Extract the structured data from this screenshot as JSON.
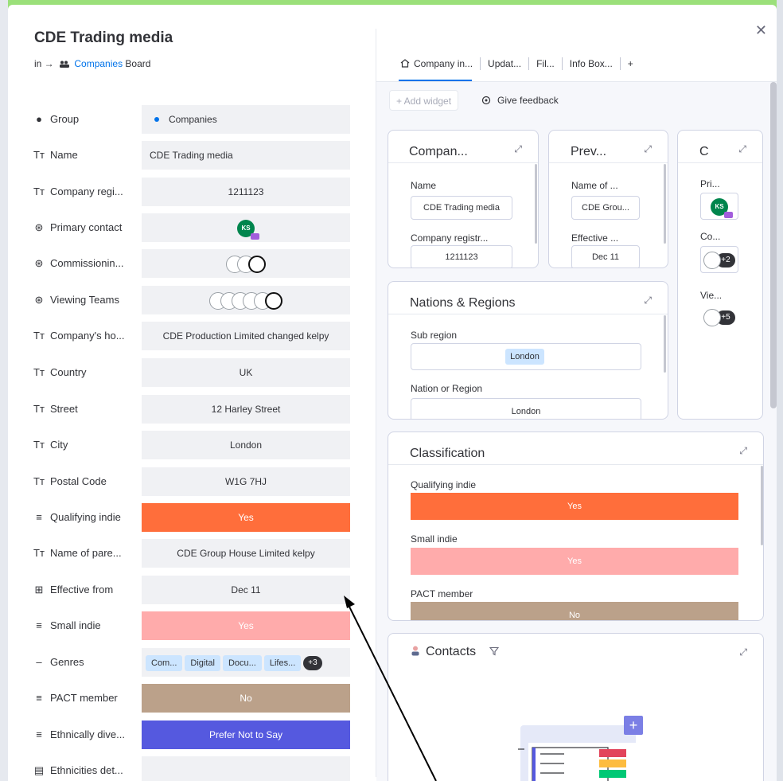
{
  "window": {
    "title": "CDE Trading media",
    "breadcrumb_prefix": "in →",
    "breadcrumb_link": "Companies",
    "breadcrumb_suffix": " Board"
  },
  "fields": [
    {
      "icon": "●",
      "label": "Group",
      "value": "Companies"
    },
    {
      "icon": "Tᴛ",
      "label": "Name",
      "value": "CDE Trading media"
    },
    {
      "icon": "Tᴛ",
      "label": "Company regi...",
      "value": "1211123"
    },
    {
      "icon": "⊛",
      "label": "Primary contact",
      "value": "KS"
    },
    {
      "icon": "⊛",
      "label": "Commissionin...",
      "value": ""
    },
    {
      "icon": "⊛",
      "label": "Viewing Teams",
      "value": ""
    },
    {
      "icon": "Tᴛ",
      "label": "Company's ho...",
      "value": "CDE Production Limited changed kelpy"
    },
    {
      "icon": "Tᴛ",
      "label": "Country",
      "value": "UK"
    },
    {
      "icon": "Tᴛ",
      "label": "Street",
      "value": "12 Harley Street"
    },
    {
      "icon": "Tᴛ",
      "label": "City",
      "value": "London"
    },
    {
      "icon": "Tᴛ",
      "label": "Postal Code",
      "value": "W1G 7HJ"
    },
    {
      "icon": "≡",
      "label": "Qualifying indie",
      "value": "Yes"
    },
    {
      "icon": "Tᴛ",
      "label": "Name of pare...",
      "value": "CDE Group House Limited kelpy"
    },
    {
      "icon": "⊞",
      "label": "Effective from",
      "value": "Dec 11"
    },
    {
      "icon": "≡",
      "label": "Small indie",
      "value": "Yes"
    },
    {
      "icon": "–",
      "label": "Genres",
      "value": ""
    },
    {
      "icon": "≡",
      "label": "PACT member",
      "value": "No"
    },
    {
      "icon": "≡",
      "label": "Ethnically dive...",
      "value": "Prefer Not to Say"
    },
    {
      "icon": "▤",
      "label": "Ethnicities det...",
      "value": ""
    }
  ],
  "genres": {
    "chips": [
      "Com...",
      "Digital",
      "Docu...",
      "Lifes..."
    ],
    "more": "+3"
  },
  "tabs": [
    "Company in...",
    "Updat...",
    "Fil...",
    "Info Box...",
    "+"
  ],
  "toolbar": {
    "add_widget": "+ Add widget",
    "give_feedback": "Give feedback"
  },
  "widgets": {
    "company": {
      "title": "Compan...",
      "name_label": "Name",
      "name_value": "CDE Trading media",
      "reg_label": "Company registr...",
      "reg_value": "1211123"
    },
    "prev": {
      "title": "Prev...",
      "name_label": "Name of ...",
      "name_value": "CDE Grou...",
      "eff_label": "Effective ...",
      "eff_value": "Dec 11"
    },
    "c": {
      "title": "C",
      "pri_label": "Pri...",
      "pri_av": "KS",
      "co_label": "Co...",
      "co_more": "+2",
      "vie_label": "Vie...",
      "vie_more": "+5"
    },
    "nations": {
      "title": "Nations & Regions",
      "sub_label": "Sub region",
      "sub_value": "London",
      "nation_label": "Nation or Region",
      "nation_value": "London"
    },
    "classification": {
      "title": "Classification",
      "q_label": "Qualifying indie",
      "q_value": "Yes",
      "s_label": "Small indie",
      "s_value": "Yes",
      "p_label": "PACT member",
      "p_value": "No"
    },
    "contacts": {
      "title": "Contacts"
    }
  },
  "colors": {
    "yes_orange": "#ff6e3b",
    "yes_pink": "#ffabab",
    "no_tan": "#bba18a",
    "prefer_purple": "#5559df",
    "link_blue": "#0073ea",
    "frame_green": "#9be07a"
  }
}
